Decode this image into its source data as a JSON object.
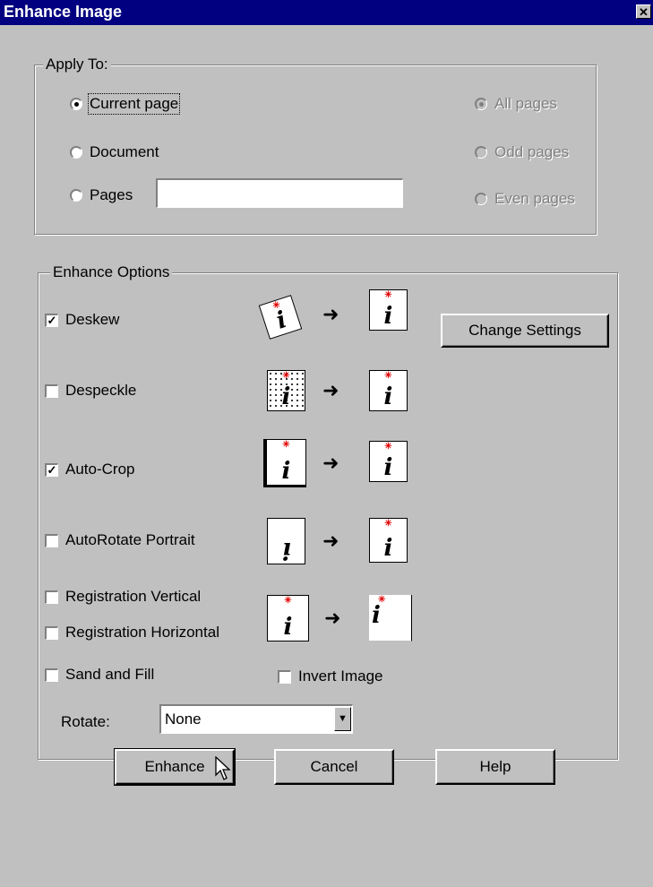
{
  "window": {
    "title": "Enhance Image",
    "close_glyph": "✕"
  },
  "apply_to": {
    "legend": "Apply To:",
    "scope_options": [
      {
        "label": "Current page",
        "selected": true
      },
      {
        "label": "Document",
        "selected": false
      },
      {
        "label": "Pages",
        "selected": false
      }
    ],
    "pages_value": "",
    "page_filter_options": [
      {
        "label": "All pages",
        "selected": true,
        "enabled": false
      },
      {
        "label": "Odd pages",
        "selected": false,
        "enabled": false
      },
      {
        "label": "Even pages",
        "selected": false,
        "enabled": false
      }
    ]
  },
  "enhance_options": {
    "legend": "Enhance Options",
    "options": [
      {
        "label": "Deskew",
        "checked": true
      },
      {
        "label": "Despeckle",
        "checked": false
      },
      {
        "label": "Auto-Crop",
        "checked": true
      },
      {
        "label": "AutoRotate Portrait",
        "checked": false
      },
      {
        "label": "Registration Vertical",
        "checked": false
      },
      {
        "label": "Registration Horizontal",
        "checked": false
      },
      {
        "label": "Sand and Fill",
        "checked": false
      }
    ],
    "invert_image": {
      "label": "Invert Image",
      "checked": false
    },
    "change_settings_label": "Change Settings",
    "rotate_label": "Rotate:",
    "rotate_value": "None",
    "illustration_glyph": "i",
    "arrow_glyph": "➜",
    "check_glyph": "✓",
    "dropdown_glyph": "▼"
  },
  "buttons": {
    "enhance": "Enhance",
    "cancel": "Cancel",
    "help": "Help"
  }
}
